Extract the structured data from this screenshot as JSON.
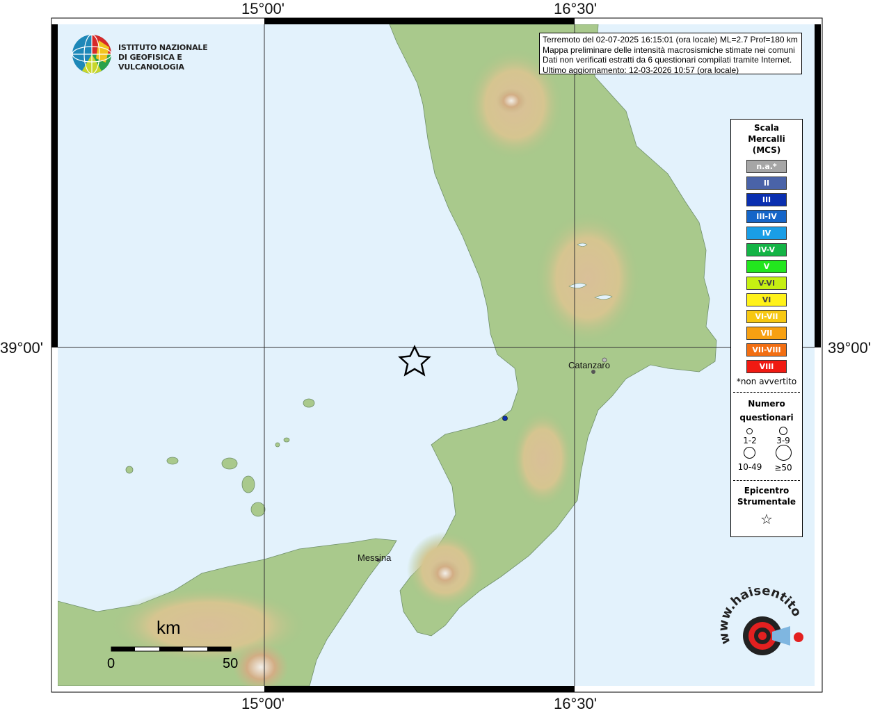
{
  "map": {
    "lon_labels": [
      "15°00'",
      "16°30'"
    ],
    "lat_label": "39°00'"
  },
  "info": {
    "line1": "Terremoto del 02-07-2025 16:15:01 (ora locale) ML=2.7 Prof=180 km",
    "line2": "Mappa preliminare delle intensità macrosismiche stimate nei comuni",
    "line3": "Dati non verificati estratti da 6 questionari compilati tramite Internet.",
    "line4": "Ultimo aggiornamento: 12-03-2026 10:57 (ora locale)"
  },
  "logo": {
    "line1": "ISTITUTO NAZIONALE",
    "line2": "DI GEOFISICA E VULCANOLOGIA"
  },
  "legend": {
    "title_l1": "Scala",
    "title_l2": "Mercalli",
    "title_l3": "(MCS)",
    "items": [
      {
        "label": "n.a.*",
        "color": "#a6a6a6"
      },
      {
        "label": "II",
        "color": "#4a63a8"
      },
      {
        "label": "III",
        "color": "#0a2fb0"
      },
      {
        "label": "III-IV",
        "color": "#1565c8"
      },
      {
        "label": "IV",
        "color": "#1a9ee6"
      },
      {
        "label": "IV-V",
        "color": "#14b446"
      },
      {
        "label": "V",
        "color": "#22e61e"
      },
      {
        "label": "V-VI",
        "color": "#c6f012"
      },
      {
        "label": "VI",
        "color": "#fff21a"
      },
      {
        "label": "VI-VII",
        "color": "#f7c812"
      },
      {
        "label": "VII",
        "color": "#f7a012"
      },
      {
        "label": "VII-VIII",
        "color": "#f26e12"
      },
      {
        "label": "VIII",
        "color": "#f01a12"
      }
    ],
    "note": "*non avvertito",
    "questionari_l1": "Numero",
    "questionari_l2": "questionari",
    "q_labels": [
      "1-2",
      "3-9",
      "10-49",
      "≥50"
    ],
    "epicentro_l1": "Epicentro",
    "epicentro_l2": "Strumentale"
  },
  "places": {
    "catanzaro": "Catanzaro",
    "messina": "Messina"
  },
  "scalebar": {
    "unit": "km",
    "min": "0",
    "max": "50"
  },
  "watermark": {
    "text": "www.haisentitoilterremoto.it"
  },
  "colors": {
    "sea": "#e3f2fc",
    "epicenter_point": "#0a2fb0"
  }
}
